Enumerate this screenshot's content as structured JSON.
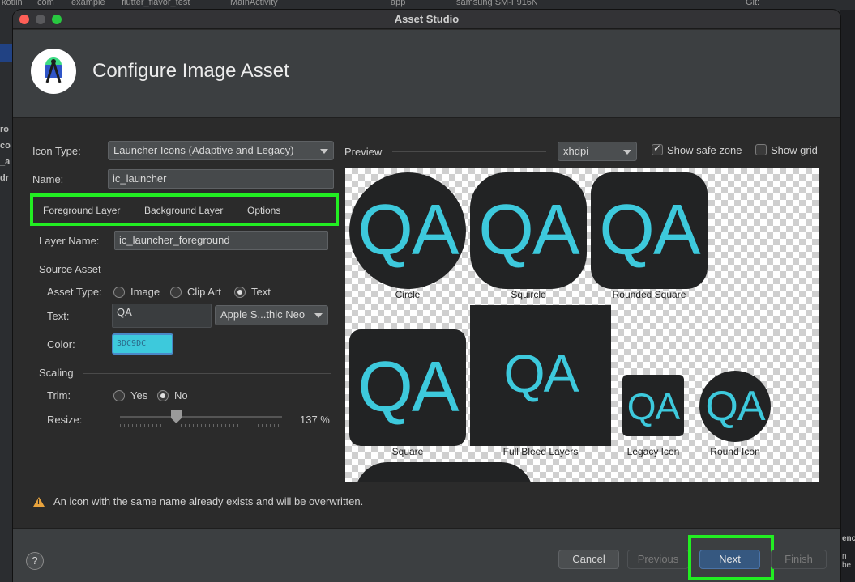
{
  "ide": {
    "breadcrumb": [
      "kotlin",
      "com",
      "example",
      "flutter_flavor_test",
      "MainActivity"
    ],
    "run_config": "app",
    "device": "samsung SM-F916N",
    "git_label": "Git:",
    "side_labels": [
      "ro",
      "co",
      "_a",
      "dr"
    ],
    "right_labels": [
      "enc",
      "n be"
    ]
  },
  "dialog": {
    "title": "Asset Studio",
    "header_title": "Configure Image Asset",
    "icon_type_label": "Icon Type:",
    "icon_type_value": "Launcher Icons (Adaptive and Legacy)",
    "name_label": "Name:",
    "name_value": "ic_launcher",
    "tabs": [
      "Foreground Layer",
      "Background Layer",
      "Options"
    ],
    "layer_name_label": "Layer Name:",
    "layer_name_value": "ic_launcher_foreground",
    "source_asset_label": "Source Asset",
    "asset_type_label": "Asset Type:",
    "asset_types": [
      "Image",
      "Clip Art",
      "Text"
    ],
    "asset_type_selected": "Text",
    "text_label": "Text:",
    "text_value": "QA",
    "font_value": "Apple S...thic Neo",
    "color_label": "Color:",
    "color_value": "3DC9DC",
    "scaling_label": "Scaling",
    "trim_label": "Trim:",
    "trim_options": [
      "Yes",
      "No"
    ],
    "trim_selected": "No",
    "resize_label": "Resize:",
    "resize_value": "137 %",
    "resize_percent": 137,
    "preview_label": "Preview",
    "density_value": "xhdpi",
    "show_safe_zone_label": "Show safe zone",
    "show_safe_zone_checked": true,
    "show_grid_label": "Show grid",
    "show_grid_checked": false,
    "preview_icon_text": "QA",
    "preview_labels": [
      "Circle",
      "Squircle",
      "Rounded Square",
      "Square",
      "Full Bleed Layers",
      "Legacy Icon",
      "Round Icon"
    ],
    "warning_text": "An icon with the same name already exists and will be overwritten.",
    "help_label": "?",
    "buttons": {
      "cancel": "Cancel",
      "previous": "Previous",
      "next": "Next",
      "finish": "Finish"
    }
  },
  "colors": {
    "accent": "#3dc9dc",
    "highlight": "#22ee22",
    "icon_bg": "#222324"
  }
}
